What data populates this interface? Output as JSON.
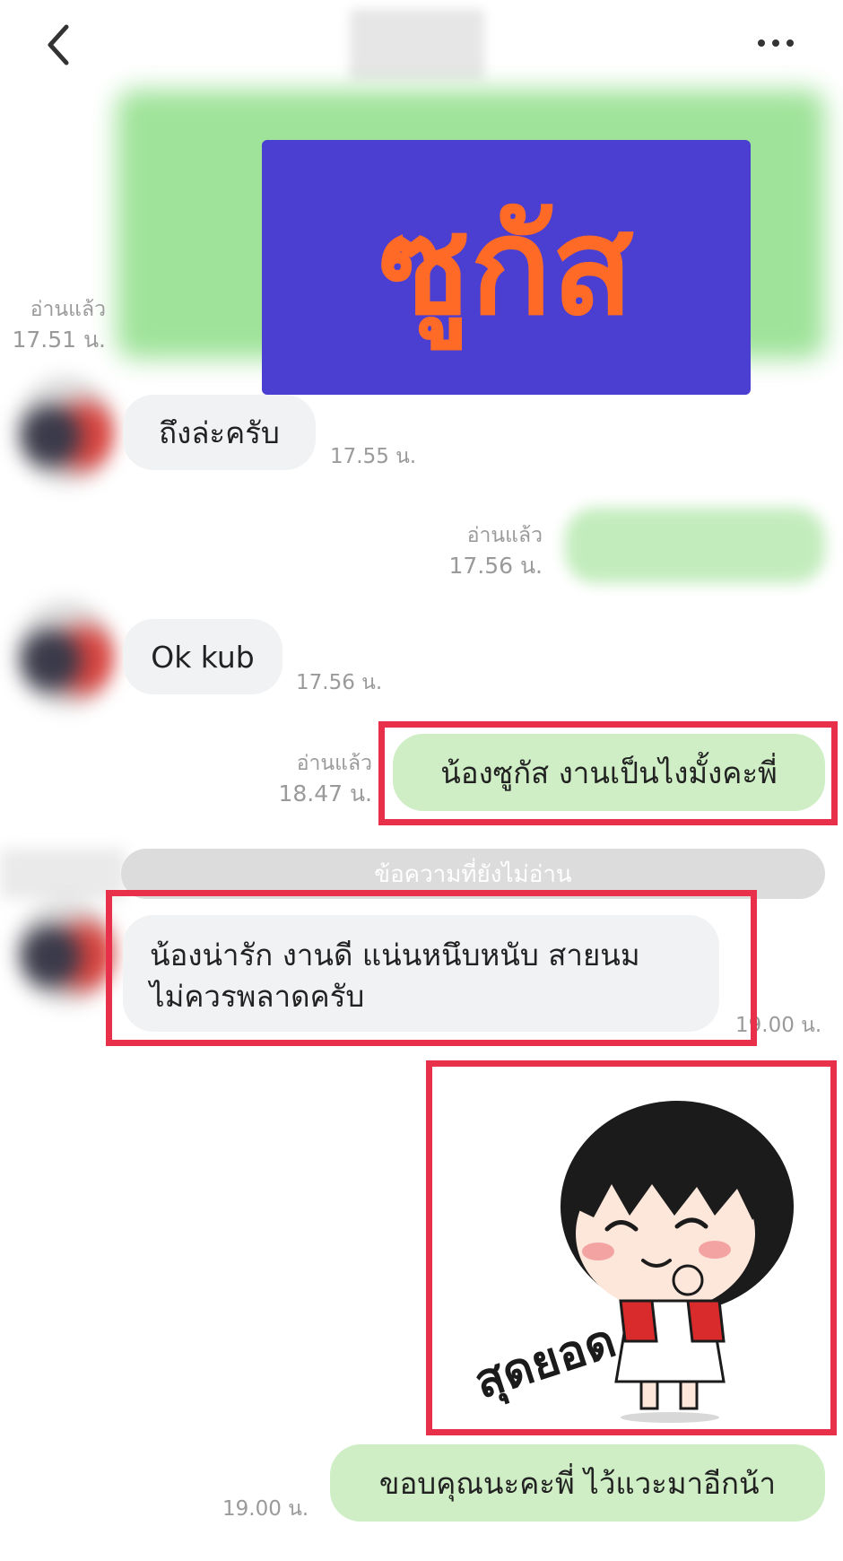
{
  "banner": {
    "text": "ซูกัส",
    "bg_color": "#4a3fd0",
    "text_color": "#ff6a26"
  },
  "messages": [
    {
      "meta_read": "อ่านแล้ว",
      "meta_time": "17.51 น."
    },
    {
      "text": "ถึงล่ะครับ",
      "time": "17.55 น."
    },
    {
      "meta_read": "อ่านแล้ว",
      "meta_time": "17.56 น."
    },
    {
      "text": "Ok kub",
      "time": "17.56 น."
    },
    {
      "text": "น้องซูกัส งานเป็นไงมั้งคะพี่",
      "meta_read": "อ่านแล้ว",
      "meta_time": "18.47 น."
    },
    {
      "text_line1": "น้องน่ารัก งานดี แน่นหนึบหนับ สายนม",
      "text_line2": "ไม่ควรพลาดครับ",
      "time": "19.00 น."
    },
    {
      "sticker_text": "สุดยอด"
    },
    {
      "text": "ขอบคุณนะคะพี่ ไว้แวะมาอีกน้า",
      "time": "19.00 น."
    }
  ],
  "unread_divider": "ข้อความที่ยังไม่อ่าน",
  "icons": {
    "back": "chevron-left-icon",
    "more": "more-horizontal-icon"
  },
  "colors": {
    "highlight": "#e8304a",
    "bubble_out": "#cfeec5",
    "bubble_in": "#f1f2f4"
  }
}
